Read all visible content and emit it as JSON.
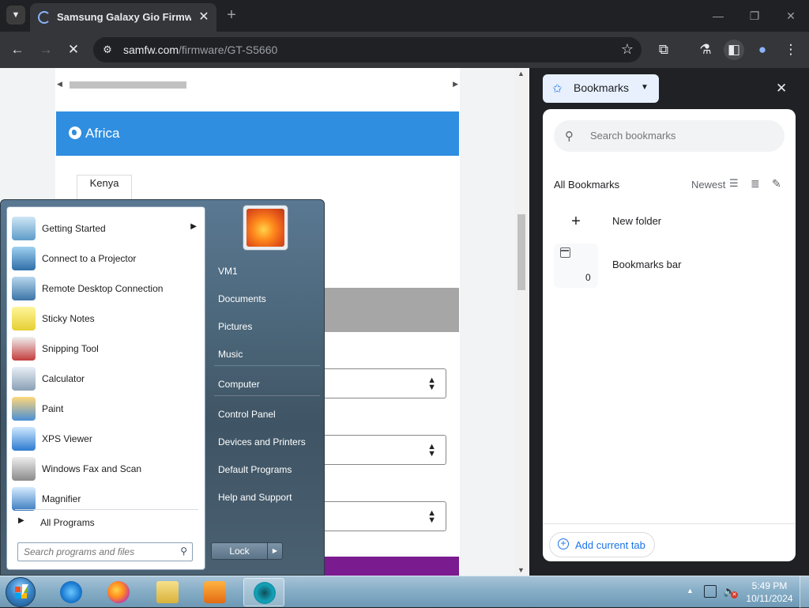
{
  "window": {
    "tab_title": "Samsung Galaxy Gio Firmware",
    "tab_close": "✕",
    "new_tab": "+",
    "controls": {
      "minimize": "—",
      "restore": "❐",
      "close": "✕"
    }
  },
  "toolbar": {
    "back": "←",
    "forward": "→",
    "reload": "✕",
    "site_info": "⚙",
    "url_host": "samfw.com",
    "url_path": "/firmware/GT-S5660",
    "star": "☆",
    "extensions": "⧉",
    "labs": "⚗",
    "side_panel": "◧",
    "profile": "●",
    "menu": "⋮"
  },
  "webpage": {
    "region_title": "Africa",
    "country_tab": "Kenya",
    "select_caret": "▲\n▼"
  },
  "bookmarks_panel": {
    "header_label": "Bookmarks",
    "header_caret": "▼",
    "close": "✕",
    "search_placeholder": "Search bookmarks",
    "all_bookmarks": "All Bookmarks",
    "sort_label": "Newest",
    "new_folder": "New folder",
    "bookmarks_bar_label": "Bookmarks bar",
    "bookmarks_bar_count": "0",
    "add_current_tab": "Add current tab"
  },
  "start_menu": {
    "programs": [
      {
        "label": "Getting Started",
        "icon": "getting-started-icon",
        "has_submenu": true
      },
      {
        "label": "Connect to a Projector",
        "icon": "projector-icon"
      },
      {
        "label": "Remote Desktop Connection",
        "icon": "remote-desktop-icon"
      },
      {
        "label": "Sticky Notes",
        "icon": "sticky-notes-icon"
      },
      {
        "label": "Snipping Tool",
        "icon": "snipping-tool-icon"
      },
      {
        "label": "Calculator",
        "icon": "calculator-icon"
      },
      {
        "label": "Paint",
        "icon": "paint-icon"
      },
      {
        "label": "XPS Viewer",
        "icon": "xps-viewer-icon"
      },
      {
        "label": "Windows Fax and Scan",
        "icon": "fax-scan-icon"
      },
      {
        "label": "Magnifier",
        "icon": "magnifier-icon"
      }
    ],
    "all_programs": "All Programs",
    "search_placeholder": "Search programs and files",
    "right_items": [
      "VM1",
      "Documents",
      "Pictures",
      "Music",
      "Computer",
      "Control Panel",
      "Devices and Printers",
      "Default Programs",
      "Help and Support"
    ],
    "lock_label": "Lock",
    "lock_arrow": "▶"
  },
  "taskbar": {
    "apps": [
      "internet-explorer-icon",
      "firefox-icon",
      "file-explorer-icon",
      "media-player-icon",
      "chrome-icon"
    ],
    "tray_arrow": "▲",
    "clock_time": "5:49 PM",
    "clock_date": "10/11/2024"
  },
  "colors": {
    "chrome_dark": "#202124",
    "chrome_toolbar": "#35363a",
    "africa_blue": "#2f8ee0",
    "bookmarks_accent": "#1a73e8",
    "startmenu_blue": "#4b6679",
    "taskbar_blue": "#87aec7"
  }
}
